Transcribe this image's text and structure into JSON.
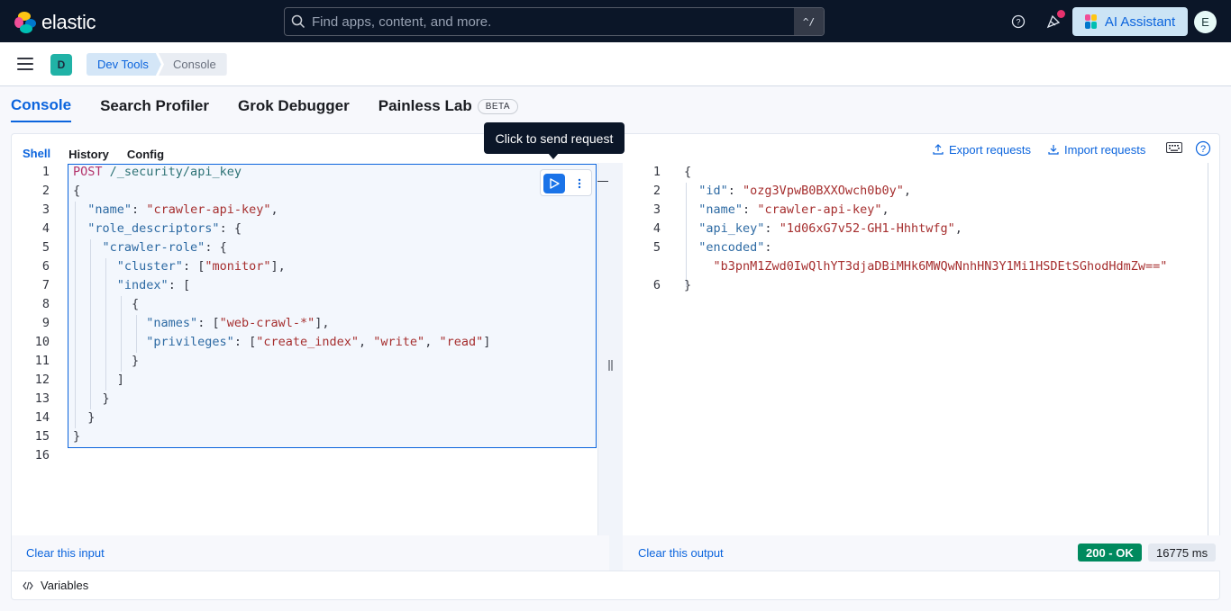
{
  "header": {
    "brand": "elastic",
    "search_placeholder": "Find apps, content, and more.",
    "search_shortcut": "^/",
    "ai_assistant_label": "AI Assistant",
    "avatar_initial": "E"
  },
  "subbar": {
    "space_initial": "D",
    "breadcrumbs": [
      "Dev Tools",
      "Console"
    ]
  },
  "app_tabs": [
    {
      "label": "Console",
      "active": true
    },
    {
      "label": "Search Profiler",
      "active": false
    },
    {
      "label": "Grok Debugger",
      "active": false
    },
    {
      "label": "Painless Lab",
      "active": false,
      "badge": "BETA"
    }
  ],
  "console": {
    "subtabs": [
      "Shell",
      "History",
      "Config"
    ],
    "export_label": "Export requests",
    "import_label": "Import requests",
    "tooltip": "Click to send request",
    "clear_input": "Clear this input",
    "clear_output": "Clear this output",
    "status": "200 - OK",
    "duration": "16775 ms",
    "variables_label": "Variables"
  },
  "input_lines": [
    "1",
    "2",
    "3",
    "4",
    "5",
    "6",
    "7",
    "8",
    "9",
    "10",
    "11",
    "12",
    "13",
    "14",
    "15",
    "16"
  ],
  "input_code": {
    "l1_method": "POST",
    "l1_url": "/_security/api_key",
    "l2": "{",
    "l3_key": "\"name\"",
    "l3_val": "\"crawler-api-key\"",
    "l4_key": "\"role_descriptors\"",
    "l5_key": "\"crawler-role\"",
    "l6_key": "\"cluster\"",
    "l6_val": "\"monitor\"",
    "l7_key": "\"index\"",
    "l9_key": "\"names\"",
    "l9_val": "\"web-crawl-*\"",
    "l10_key": "\"privileges\"",
    "l10_v1": "\"create_index\"",
    "l10_v2": "\"write\"",
    "l10_v3": "\"read\""
  },
  "output_lines": [
    "1",
    "2",
    "3",
    "4",
    "5",
    "6"
  ],
  "output_code": {
    "id_key": "\"id\"",
    "id_val": "\"ozg3VpwB0BXXOwch0b0y\"",
    "name_key": "\"name\"",
    "name_val": "\"crawler-api-key\"",
    "apikey_key": "\"api_key\"",
    "apikey_val": "\"1d06xG7v52-GH1-Hhhtwfg\"",
    "encoded_key": "\"encoded\"",
    "encoded_val": "\"b3pnM1Zwd0IwQlhYT3djaDBiMHk6MWQwNnhHN3Y1Mi1HSDEtSGhodHdmZw==\""
  },
  "colors": {
    "accent": "#0b64dd",
    "header_bg": "#0b1628",
    "success": "#008a5e"
  }
}
